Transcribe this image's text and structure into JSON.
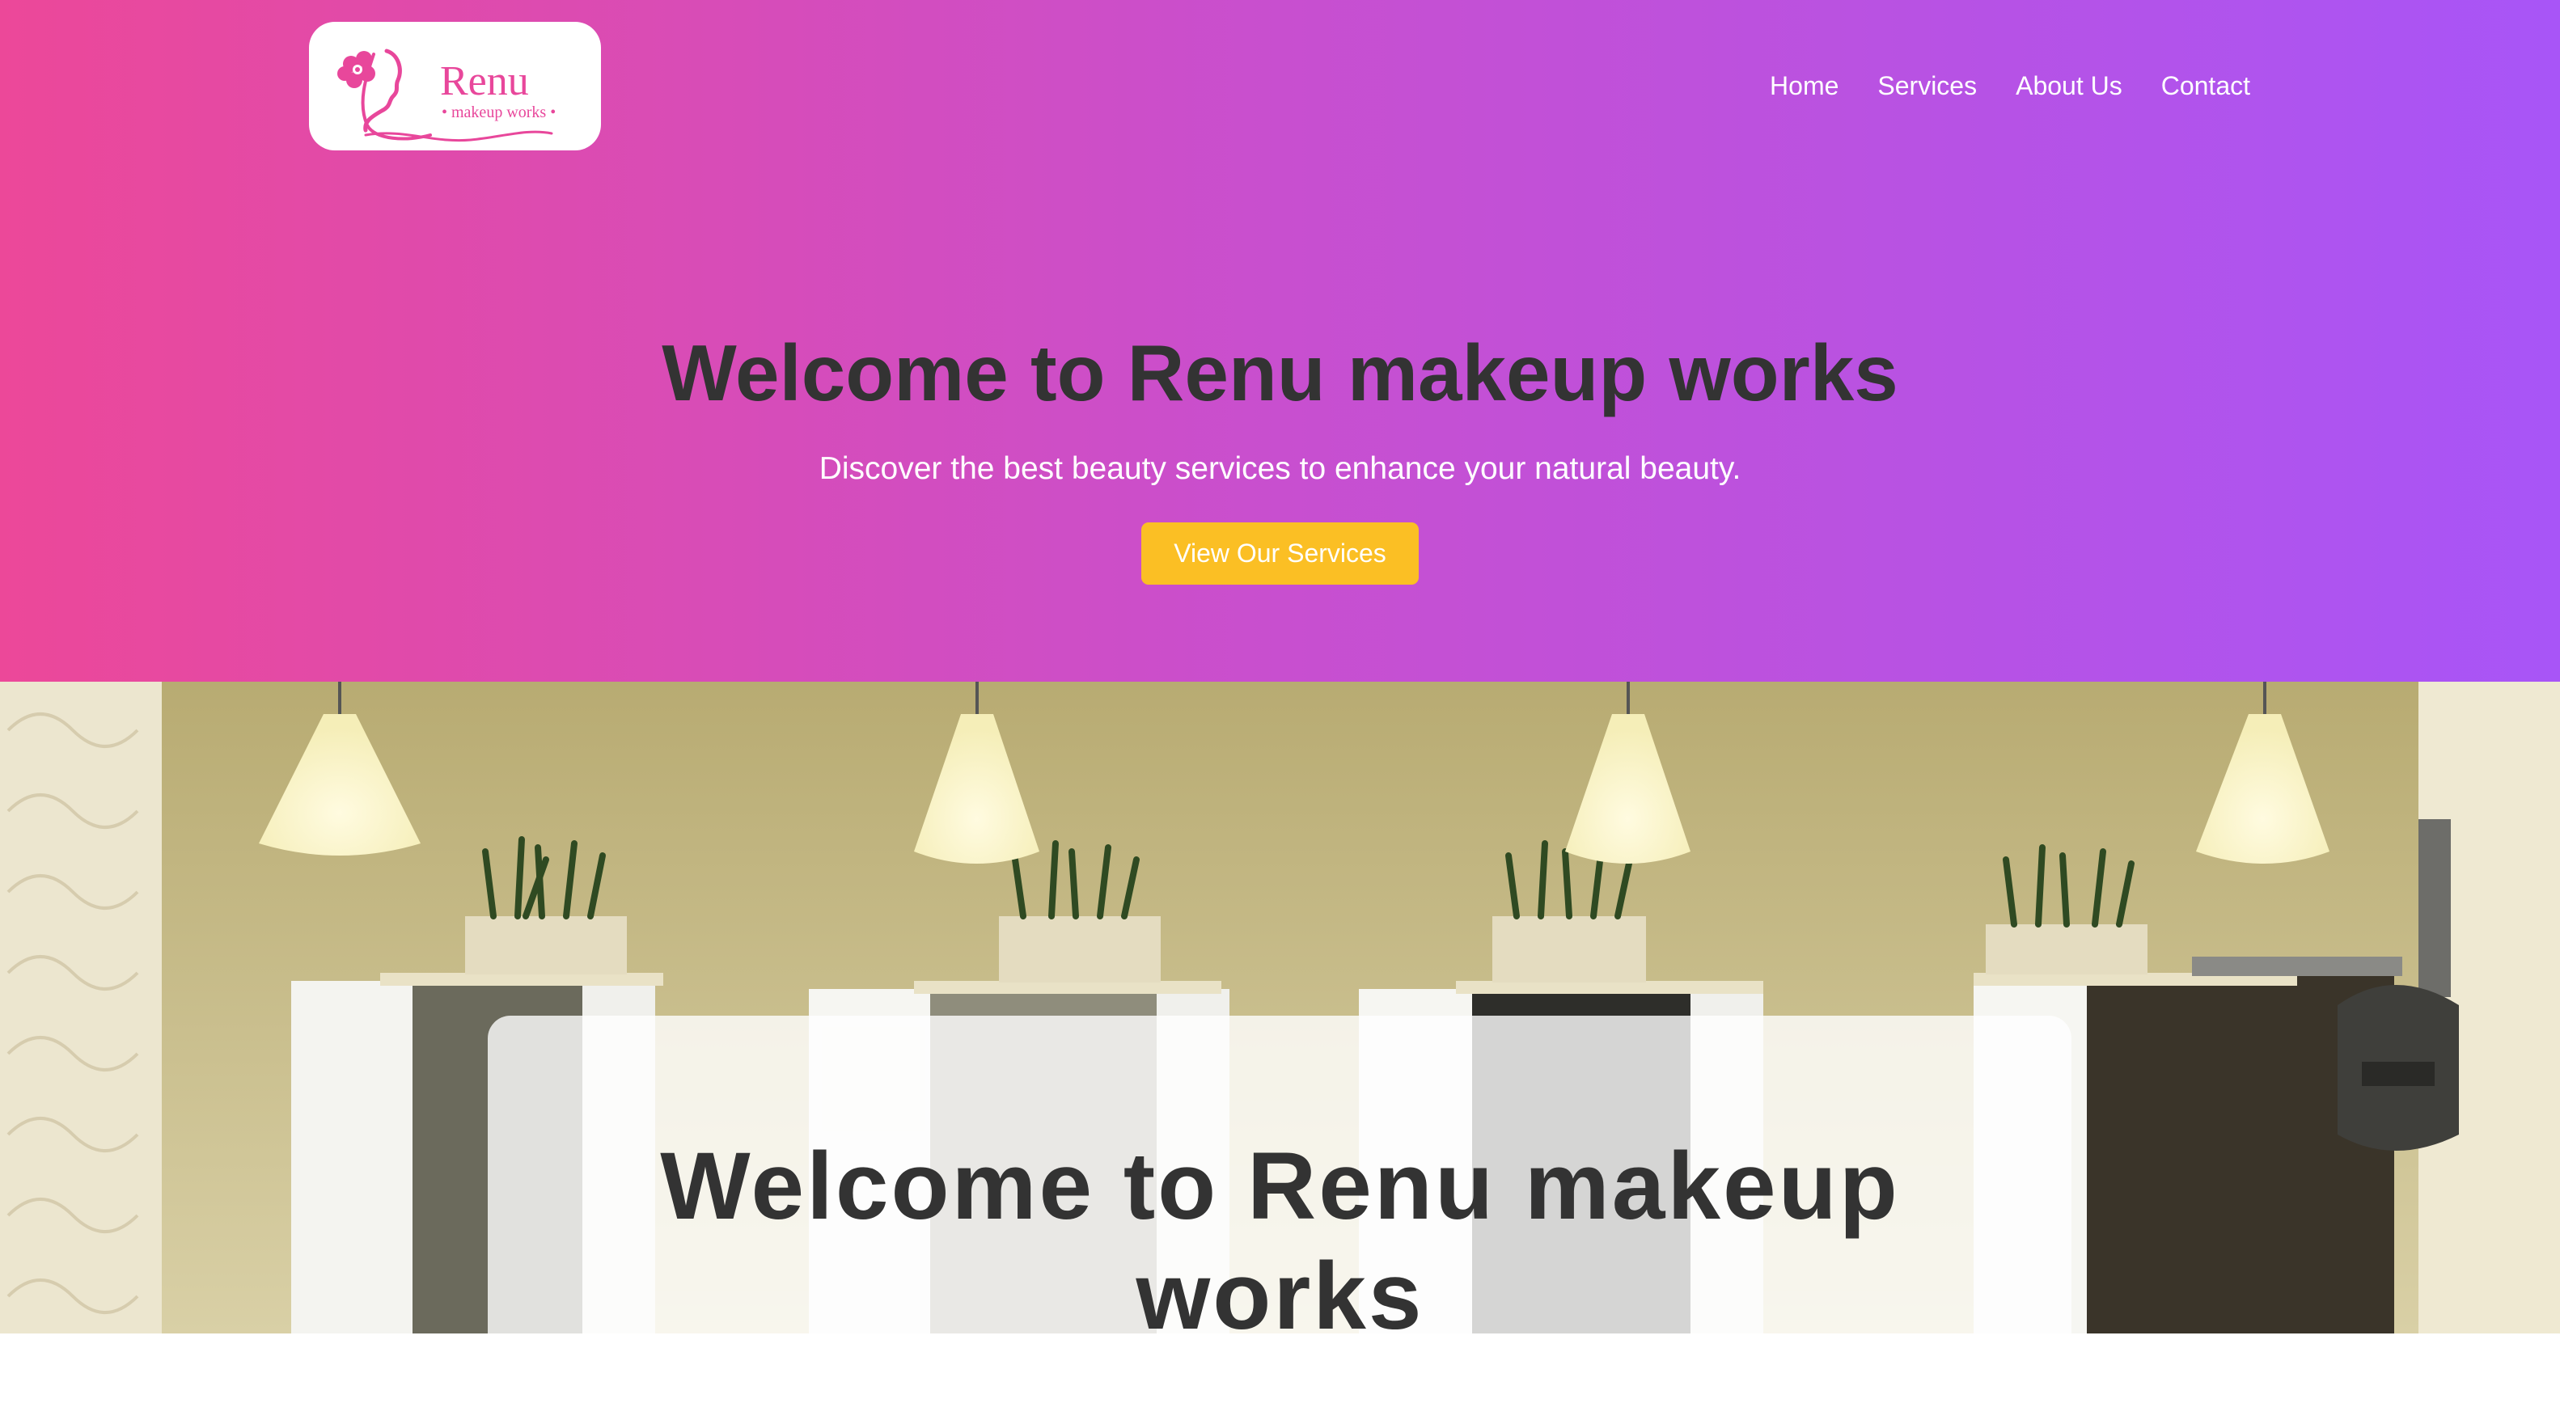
{
  "brand": {
    "logo_name": "Renu",
    "logo_tagline": "makeup works",
    "logo_icon": "woman-face-flower-icon"
  },
  "nav": {
    "items": [
      {
        "label": "Home"
      },
      {
        "label": "Services"
      },
      {
        "label": "About Us"
      },
      {
        "label": "Contact"
      }
    ]
  },
  "hero": {
    "title": "Welcome to Renu makeup works",
    "subtitle": "Discover the best beauty services to enhance your natural beauty.",
    "cta_label": "View Our Services"
  },
  "salon_section": {
    "image": "salon-interior-photo",
    "title": "Welcome to Renu makeup works"
  },
  "colors": {
    "gradient_start": "#ec4899",
    "gradient_end": "#a855f7",
    "cta": "#fbbf24",
    "heading_text": "#333333",
    "logo_pink": "#e8479b"
  }
}
